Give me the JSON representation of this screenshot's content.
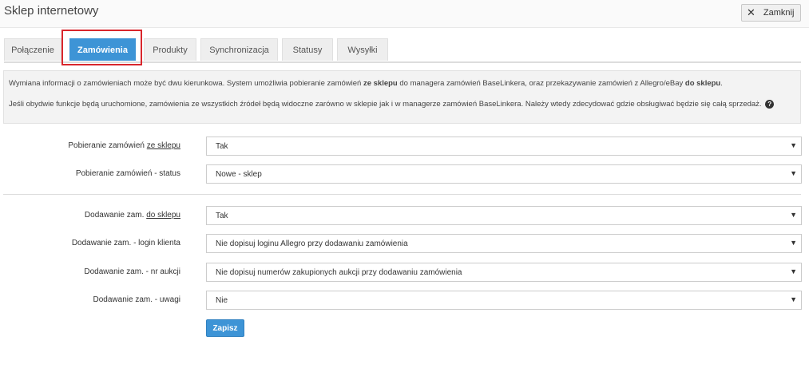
{
  "window": {
    "title": "Sklep internetowy",
    "close_label": "Zamknij"
  },
  "tabs": [
    {
      "label": "Połączenie"
    },
    {
      "label": "Zamówienia",
      "active": true
    },
    {
      "label": "Produkty"
    },
    {
      "label": "Synchronizacja"
    },
    {
      "label": "Statusy"
    },
    {
      "label": "Wysyłki"
    }
  ],
  "info": {
    "p1_a": "Wymiana informacji o zamówieniach może być dwu kierunkowa. System umożliwia pobieranie zamówień ",
    "p1_b": "ze sklepu",
    "p1_c": " do managera zamówień BaseLinkera, oraz przekazywanie zamówień z Allegro/eBay ",
    "p1_d": "do sklepu",
    "p1_e": ".",
    "p2": "Jeśli obydwie funkcje będą uruchomione, zamówienia ze wszystkich źródeł będą widoczne zarówno w sklepie jak i w managerze zamówień BaseLinkera. Należy wtedy zdecydować gdzie obsługiwać będzie się całą sprzedaż.",
    "help_icon": "question-circle-icon"
  },
  "form": {
    "shop_fetch": {
      "label_a": "Pobieranie zamówień ",
      "label_u": "ze sklepu",
      "value": "Tak"
    },
    "shop_status": {
      "label": "Pobieranie zamówień - status",
      "value": "Nowe - sklep"
    },
    "add_to_shop": {
      "label_a": "Dodawanie zam. ",
      "label_u": "do sklepu",
      "value": "Tak"
    },
    "login": {
      "label": "Dodawanie zam. - login klienta",
      "value": "Nie dopisuj loginu Allegro przy dodawaniu zamówienia"
    },
    "auction_nr": {
      "label": "Dodawanie zam. - nr aukcji",
      "value": "Nie dopisuj numerów zakupionych aukcji przy dodawaniu zamówienia"
    },
    "notes": {
      "label": "Dodawanie zam. - uwagi",
      "value": "Nie"
    },
    "caret": "▼",
    "save_label": "Zapisz"
  },
  "colors": {
    "accent": "#3d94d6",
    "highlight": "#d9262c"
  }
}
